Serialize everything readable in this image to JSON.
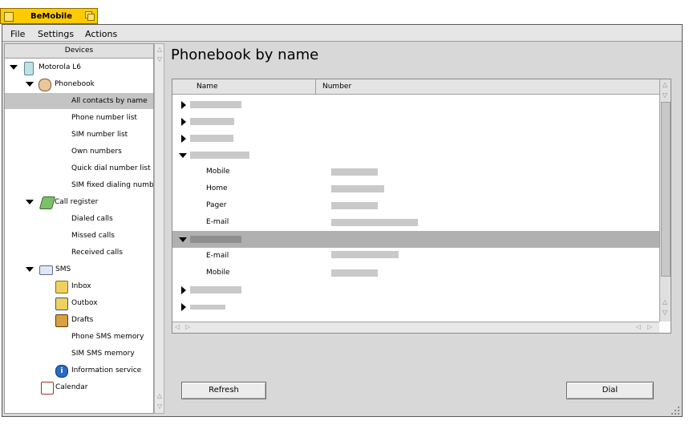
{
  "window": {
    "title": "BeMobile"
  },
  "menu": [
    "File",
    "Settings",
    "Actions"
  ],
  "sidebar": {
    "header": "Devices",
    "device": "Motorola L6",
    "phonebook": {
      "label": "Phonebook",
      "items": [
        "All contacts by name",
        "Phone number list",
        "SIM number list",
        "Own numbers",
        "Quick dial number list",
        "SIM fixed dialing number"
      ]
    },
    "call_register": {
      "label": "Call register",
      "items": [
        "Dialed calls",
        "Missed calls",
        "Received calls"
      ]
    },
    "sms": {
      "label": "SMS",
      "items": [
        "Inbox",
        "Outbox",
        "Drafts",
        "Phone SMS memory",
        "SIM SMS memory",
        "Information service"
      ]
    },
    "calendar": "Calendar",
    "selected": "All contacts by name"
  },
  "main": {
    "title": "Phonebook by name",
    "columns": [
      "Name",
      "Number"
    ],
    "detail_labels": {
      "mobile": "Mobile",
      "home": "Home",
      "pager": "Pager",
      "email": "E-mail"
    },
    "buttons": {
      "refresh": "Refresh",
      "dial": "Dial"
    }
  },
  "colors": {
    "tab_yellow": "#ffcb00",
    "selection": "#b0b0b0"
  }
}
